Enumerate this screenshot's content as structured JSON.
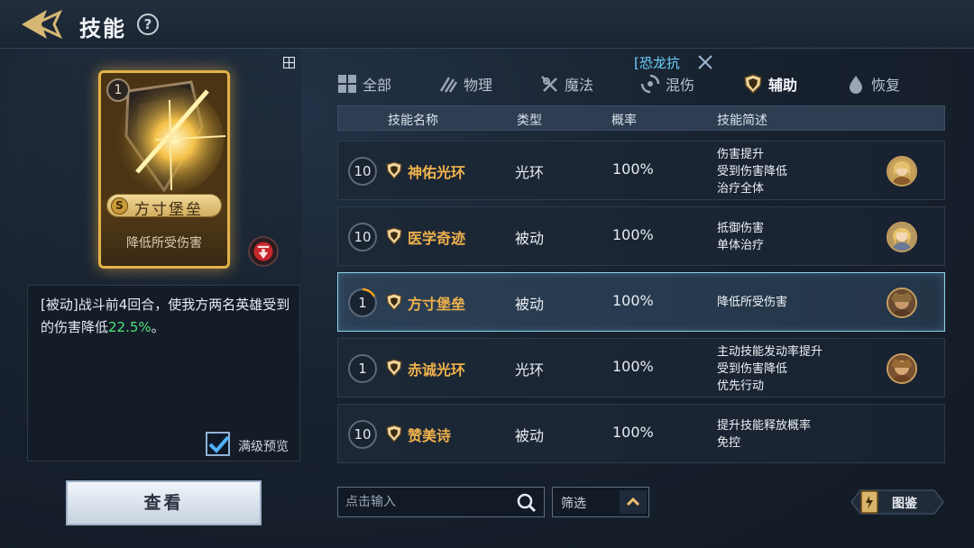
{
  "header": {
    "title": "技能",
    "help": "?"
  },
  "card": {
    "level": "1",
    "grade": "S",
    "name": "方寸堡垒",
    "short_desc": "降低所受伤害"
  },
  "description": {
    "prefix": "[被动]战斗前4回合，使我方两名英雄受到的伤害降低",
    "highlight": "22.5%",
    "suffix": "。"
  },
  "max_level_preview": {
    "label": "满级预览",
    "checked": true
  },
  "view_button": "查看",
  "active_filter": {
    "label": "[恐龙抗"
  },
  "tabs": [
    {
      "label": "全部",
      "icon": "grid-icon"
    },
    {
      "label": "物理",
      "icon": "claw-icon"
    },
    {
      "label": "魔法",
      "icon": "magic-icon"
    },
    {
      "label": "混伤",
      "icon": "mixed-icon"
    },
    {
      "label": "辅助",
      "icon": "shield-icon",
      "active": true
    },
    {
      "label": "恢复",
      "icon": "droplet-icon"
    }
  ],
  "table": {
    "headers": {
      "name": "技能名称",
      "type": "类型",
      "rate": "概率",
      "brief": "技能简述"
    },
    "rows": [
      {
        "level": "10",
        "name": "神佑光环",
        "type": "光环",
        "rate": "100%",
        "brief": [
          "伤害提升",
          "受到伤害降低",
          "治疗全体"
        ]
      },
      {
        "level": "10",
        "name": "医学奇迹",
        "type": "被动",
        "rate": "100%",
        "brief": [
          "抵御伤害",
          "单体治疗"
        ]
      },
      {
        "level": "1",
        "name": "方寸堡垒",
        "type": "被动",
        "rate": "100%",
        "brief": [
          "降低所受伤害"
        ],
        "selected": true
      },
      {
        "level": "1",
        "name": "赤诚光环",
        "type": "光环",
        "rate": "100%",
        "brief": [
          "主动技能发动率提升",
          "受到伤害降低",
          "优先行动"
        ]
      },
      {
        "level": "10",
        "name": "赞美诗",
        "type": "被动",
        "rate": "100%",
        "brief": [
          "提升技能释放概率",
          "免控"
        ]
      }
    ]
  },
  "search": {
    "placeholder": "点击输入"
  },
  "filter": {
    "label": "筛选"
  },
  "codex": {
    "label": "图鉴"
  },
  "colors": {
    "accent_gold": "#f0b24c",
    "highlight_green": "#4ee37a",
    "filter_blue": "#6dd2ff"
  }
}
